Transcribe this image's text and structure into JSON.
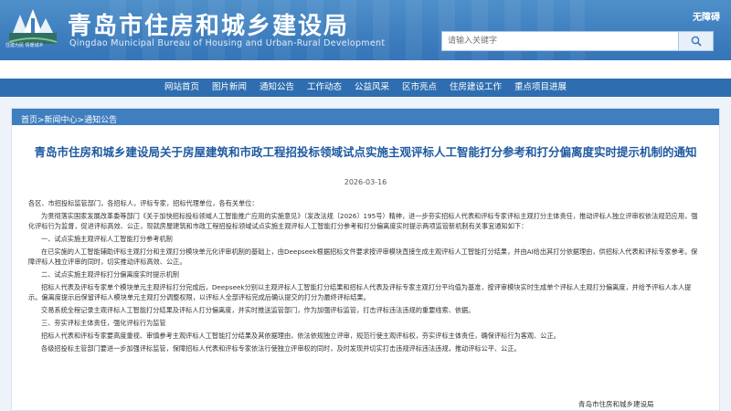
{
  "header": {
    "site_title": "青岛市住房和城乡建设局",
    "site_subtitle": "Qingdao Municipal Bureau of Housing and Urban-Rural Development",
    "logo_caption": "住建为民 情暖城乡",
    "barrier_free": "无障碍",
    "search_placeholder": "请输入关键字"
  },
  "nav": {
    "items": [
      {
        "label": "网站首页"
      },
      {
        "label": "图片新闻"
      },
      {
        "label": "通知公告"
      },
      {
        "label": "工作动态"
      },
      {
        "label": "公益风采"
      },
      {
        "label": "区市亮点"
      },
      {
        "label": "住房建设工作"
      },
      {
        "label": "重点项目进展"
      }
    ]
  },
  "breadcrumb": "首页>新闻中心>通知公告",
  "article": {
    "title": "青岛市住房和城乡建设局关于房屋建筑和市政工程招投标领域试点实施主观评标人工智能打分参考和打分偏离度实时提示机制的通知",
    "date": "2026-03-16",
    "salutation": "各区、市招投标监管部门，各招标人，评标专家，招标代理单位，各有关单位：",
    "intro": "为贯彻落实国家发展改革委等部门《关于加快招标投标领域人工智能推广应用的实施意见》（发改法规〔2026〕195号）精神，进一步夯实招标人代表和评标专家评标主观打分主体责任，推动评标人独立评审权依法规范应用，强化评标行为监督，促进评标高效、公正，现就房屋建筑和市政工程招投标领域试点实施主观评标人工智能打分参考和打分偏离度实时提示两项监管新机制有关事宜通知如下：",
    "section1_heading": "一、试点实施主观评标人工智能打分参考机制",
    "section1_body": "在已实施的人工智能辅助评标主观打分和主观打分模块单元化评审机制的基础上，由Deepseek根据招标文件要求按评审模块直接生成主观评标人工智能打分结果，并由AI给出其打分依据理由，供招标人代表和评标专家参考。保障评标人独立评审的同时，切实推动评标高效、公正。",
    "section2_heading": "二、试点实施主观评标打分偏离度实时提示机制",
    "section2_body": "招标人代表及评标专家单个模块单元主观评标打分完成后，Deepseek分别以主观评标人工智能打分结果和招标人代表及评标专家主观打分平均值为基准，按评审模块实时生成单个评标人主观打分偏离度，并给予评标人本人提示。偏离度提示后保留评标人模块单元主观打分调整权限，以评标人全部评标完成后确认提交的打分为最终评标结果。",
    "para3": "交易系统全程记录主观评标人工智能打分结果及评标人打分偏离度，并实时推送监管部门，作为加强评标监管，打击评标违法违规的重要线索、依据。",
    "section3_heading": "三、夯实评标主体责任，强化评标行为监管",
    "section3_body": "招标人代表和评标专家要高度重视、审慎参考主观评标人工智能打分结果及其依据理由，依法依规独立评审，规范行使主观评标权，夯实评标主体责任，确保评标行为客观、公正。",
    "para5": "各级招投标主管部门要进一步加强评标监管，保障招标人代表和评标专家依法行使独立评审权的同时，及时发现并切实打击违规评标违法违规，推动评标公平、公正。",
    "signature": "青岛市住房和城乡建设局"
  }
}
